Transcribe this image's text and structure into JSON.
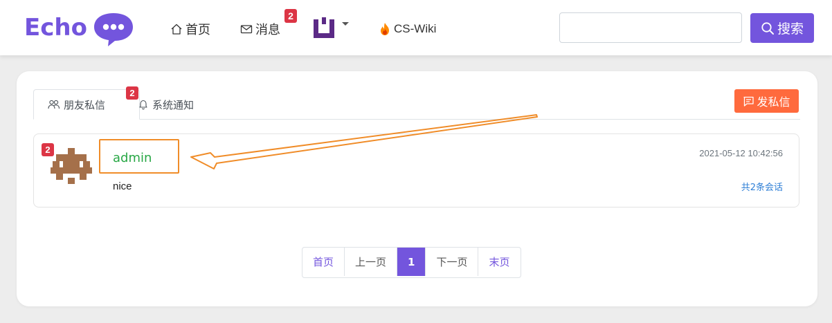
{
  "brand": {
    "name": "Echo",
    "accent": "#7355dd"
  },
  "nav": {
    "home": {
      "label": "首页",
      "icon": "home-icon"
    },
    "messages": {
      "label": "消息",
      "icon": "mail-icon",
      "badge": "2"
    },
    "user": {
      "icon": "user-avatar-icon"
    },
    "wiki": {
      "label": "CS-Wiki",
      "icon": "fire-icon"
    }
  },
  "search": {
    "placeholder": "",
    "value": "",
    "button_label": "搜索"
  },
  "tabs": [
    {
      "label": "朋友私信",
      "badge": "2",
      "icon": "users-icon",
      "active": true
    },
    {
      "label": "系统通知",
      "icon": "bell-icon",
      "active": false
    }
  ],
  "send_button": {
    "label": "发私信",
    "color": "#ff6a3d"
  },
  "conversations": [
    {
      "name": "admin",
      "unread": "2",
      "message": "nice",
      "time": "2021-05-12 10:42:56",
      "count_label": "共2条会话"
    }
  ],
  "pagination": {
    "first": "首页",
    "prev": "上一页",
    "current": "1",
    "next": "下一页",
    "last": "末页"
  }
}
